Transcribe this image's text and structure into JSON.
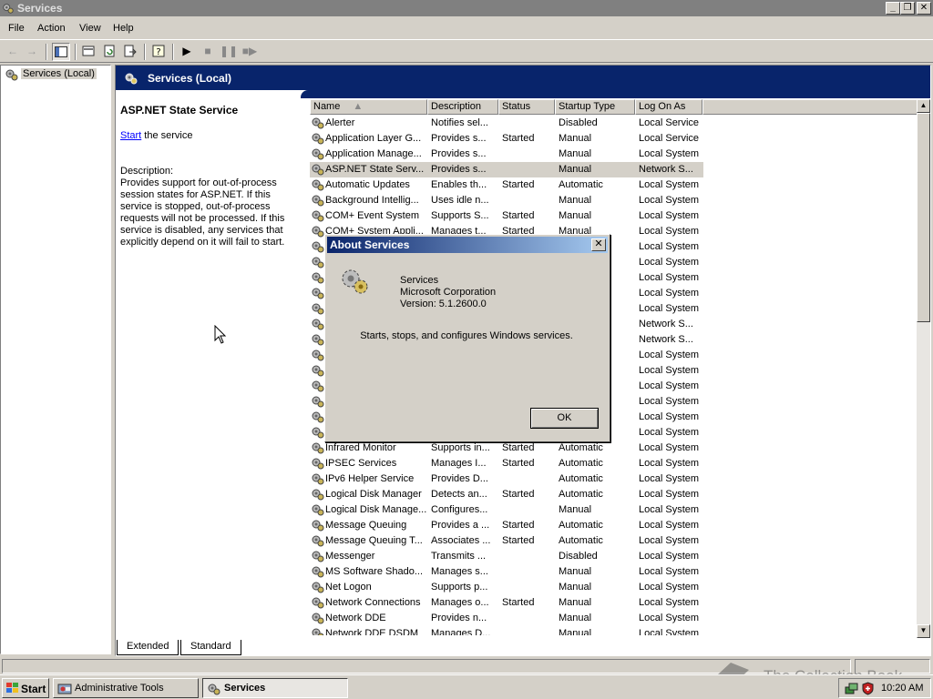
{
  "window": {
    "title": "Services"
  },
  "menu": {
    "items": [
      "File",
      "Action",
      "View",
      "Help"
    ]
  },
  "toolbar": {
    "icons": [
      "back-arrow-icon",
      "forward-arrow-icon",
      "show-hide-tree-icon",
      "properties-icon",
      "refresh-icon",
      "export-list-icon",
      "help-icon",
      "play-icon",
      "stop-icon",
      "pause-icon",
      "restart-icon"
    ]
  },
  "tree": {
    "root_label": "Services (Local)"
  },
  "banner": {
    "title": "Services (Local)"
  },
  "extended": {
    "service_title": "ASP.NET State Service",
    "start_link": "Start",
    "start_suffix": " the service",
    "description_label": "Description:",
    "description": "Provides support for out-of-process session states for ASP.NET. If this service is stopped, out-of-process requests will not be processed. If this service is disabled, any services that explicitly depend on it will fail to start."
  },
  "columns": [
    "Name",
    "Description",
    "Status",
    "Startup Type",
    "Log On As"
  ],
  "rows": [
    {
      "name": "Alerter",
      "desc": "Notifies sel...",
      "status": "",
      "startup": "Disabled",
      "logon": "Local Service"
    },
    {
      "name": "Application Layer G...",
      "desc": "Provides s...",
      "status": "Started",
      "startup": "Manual",
      "logon": "Local Service"
    },
    {
      "name": "Application Manage...",
      "desc": "Provides s...",
      "status": "",
      "startup": "Manual",
      "logon": "Local System"
    },
    {
      "name": "ASP.NET State Serv...",
      "desc": "Provides s...",
      "status": "",
      "startup": "Manual",
      "logon": "Network S...",
      "selected": true
    },
    {
      "name": "Automatic Updates",
      "desc": "Enables th...",
      "status": "Started",
      "startup": "Automatic",
      "logon": "Local System"
    },
    {
      "name": "Background Intellig...",
      "desc": "Uses idle n...",
      "status": "",
      "startup": "Manual",
      "logon": "Local System"
    },
    {
      "name": "COM+ Event System",
      "desc": "Supports S...",
      "status": "Started",
      "startup": "Manual",
      "logon": "Local System"
    },
    {
      "name": "COM+ System Appli...",
      "desc": "Manages t...",
      "status": "Started",
      "startup": "Manual",
      "logon": "Local System"
    },
    {
      "name": "",
      "desc": "",
      "status": "",
      "startup": "",
      "logon": "Local System"
    },
    {
      "name": "",
      "desc": "",
      "status": "",
      "startup": "",
      "logon": "Local System"
    },
    {
      "name": "",
      "desc": "",
      "status": "",
      "startup": "",
      "logon": "Local System"
    },
    {
      "name": "",
      "desc": "",
      "status": "",
      "startup": "",
      "logon": "Local System"
    },
    {
      "name": "",
      "desc": "",
      "status": "",
      "startup": "",
      "logon": "Local System"
    },
    {
      "name": "",
      "desc": "",
      "status": "",
      "startup": "",
      "logon": "Network S..."
    },
    {
      "name": "",
      "desc": "",
      "status": "",
      "startup": "",
      "logon": "Network S..."
    },
    {
      "name": "",
      "desc": "",
      "status": "",
      "startup": "",
      "logon": "Local System"
    },
    {
      "name": "",
      "desc": "",
      "status": "",
      "startup": "",
      "logon": "Local System"
    },
    {
      "name": "",
      "desc": "",
      "status": "",
      "startup": "",
      "logon": "Local System"
    },
    {
      "name": "",
      "desc": "",
      "status": "",
      "startup": "",
      "logon": "Local System"
    },
    {
      "name": "",
      "desc": "",
      "status": "",
      "startup": "",
      "logon": "Local System"
    },
    {
      "name": "",
      "desc": "",
      "status": "",
      "startup": "",
      "logon": "Local System"
    },
    {
      "name": "Infrared Monitor",
      "desc": "Supports in...",
      "status": "Started",
      "startup": "Automatic",
      "logon": "Local System"
    },
    {
      "name": "IPSEC Services",
      "desc": "Manages I...",
      "status": "Started",
      "startup": "Automatic",
      "logon": "Local System"
    },
    {
      "name": "IPv6 Helper Service",
      "desc": "Provides D...",
      "status": "",
      "startup": "Automatic",
      "logon": "Local System"
    },
    {
      "name": "Logical Disk Manager",
      "desc": "Detects an...",
      "status": "Started",
      "startup": "Automatic",
      "logon": "Local System"
    },
    {
      "name": "Logical Disk Manage...",
      "desc": "Configures...",
      "status": "",
      "startup": "Manual",
      "logon": "Local System"
    },
    {
      "name": "Message Queuing",
      "desc": "Provides a ...",
      "status": "Started",
      "startup": "Automatic",
      "logon": "Local System"
    },
    {
      "name": "Message Queuing T...",
      "desc": "Associates ...",
      "status": "Started",
      "startup": "Automatic",
      "logon": "Local System"
    },
    {
      "name": "Messenger",
      "desc": "Transmits ...",
      "status": "",
      "startup": "Disabled",
      "logon": "Local System"
    },
    {
      "name": "MS Software Shado...",
      "desc": "Manages s...",
      "status": "",
      "startup": "Manual",
      "logon": "Local System"
    },
    {
      "name": "Net Logon",
      "desc": "Supports p...",
      "status": "",
      "startup": "Manual",
      "logon": "Local System"
    },
    {
      "name": "Network Connections",
      "desc": "Manages o...",
      "status": "Started",
      "startup": "Manual",
      "logon": "Local System"
    },
    {
      "name": "Network DDE",
      "desc": "Provides n...",
      "status": "",
      "startup": "Manual",
      "logon": "Local System"
    },
    {
      "name": "Network DDE DSDM",
      "desc": "Manages D...",
      "status": "",
      "startup": "Manual",
      "logon": "Local System"
    }
  ],
  "tabs": [
    "Extended",
    "Standard"
  ],
  "dialog": {
    "title": "About Services",
    "product": "Services",
    "company": "Microsoft Corporation",
    "version": "Version: 5.1.2600.0",
    "message": "Starts, stops, and configures Windows services.",
    "ok_label": "OK"
  },
  "taskbar": {
    "start_label": "Start",
    "buttons": [
      "Administrative Tools",
      "Services"
    ],
    "clock": "10:20 AM"
  },
  "watermark": {
    "text": "The Collection Book"
  },
  "colors": {
    "banner": "#08246b",
    "dialog_title_start": "#0a246a",
    "dialog_title_end": "#a6caf0",
    "link": "#0000ff"
  }
}
